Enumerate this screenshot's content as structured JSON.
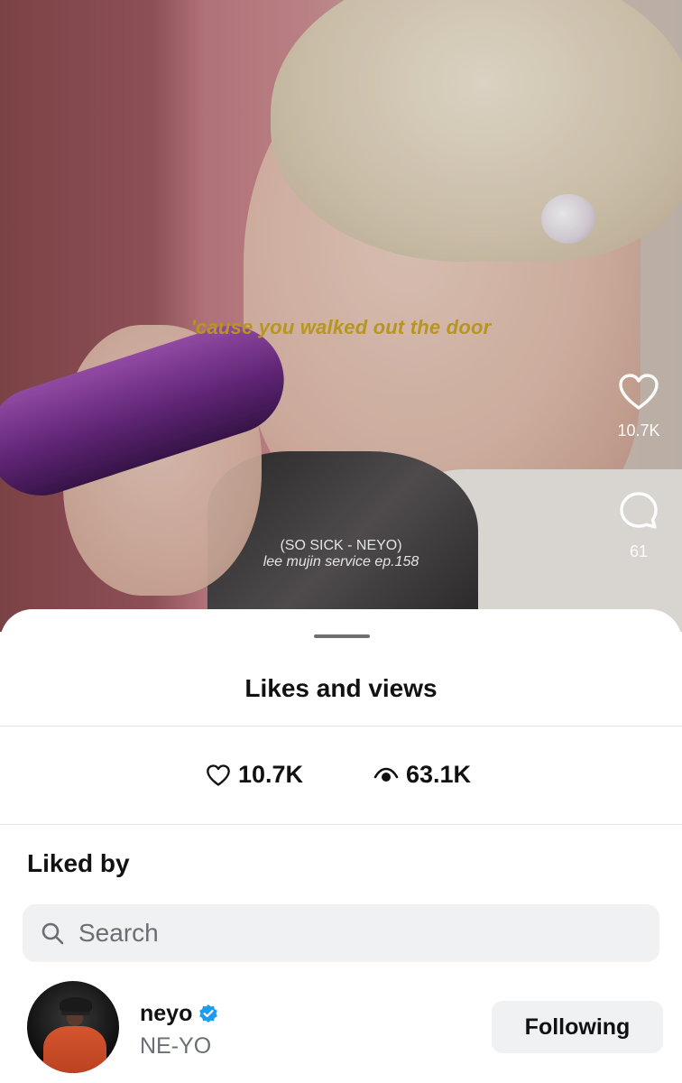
{
  "video": {
    "lyric": "'cause you walked out the door",
    "credit_line1": "(SO SICK - NEYO)",
    "credit_line2": "lee mujin service ep.158",
    "likes_count": "10.7K",
    "comments_count": "61"
  },
  "sheet": {
    "title": "Likes and views",
    "likes": "10.7K",
    "views": "63.1K",
    "section_label": "Liked by",
    "search_placeholder": "Search"
  },
  "users": [
    {
      "username": "neyo",
      "display_name": "NE-YO",
      "verified": true,
      "button_label": "Following"
    }
  ],
  "colors": {
    "lyric": "#b8951e",
    "verified": "#1d9bf0",
    "accent_text": "#111111"
  }
}
